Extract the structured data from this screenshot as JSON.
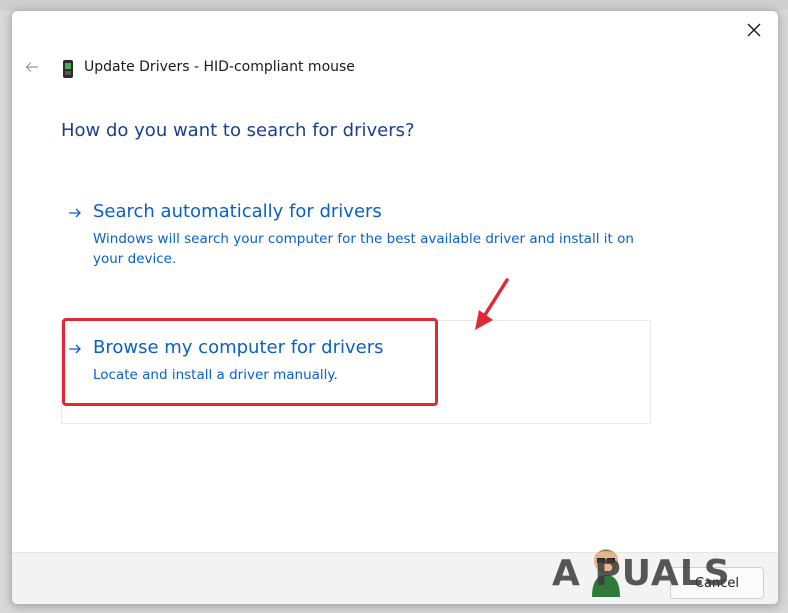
{
  "dialog": {
    "title": "Update Drivers - HID-compliant mouse",
    "heading": "How do you want to search for drivers?",
    "options": [
      {
        "title": "Search automatically for drivers",
        "description": "Windows will search your computer for the best available driver and install it on your device."
      },
      {
        "title": "Browse my computer for drivers",
        "description": "Locate and install a driver manually."
      }
    ],
    "cancel_label": "Cancel"
  },
  "watermark": {
    "text": "A PUALS"
  },
  "icons": {
    "close": "close-icon",
    "back": "back-arrow-icon",
    "device": "mouse-device-icon",
    "option_arrow": "arrow-right-icon",
    "callout": "red-callout-arrow-icon"
  },
  "colors": {
    "heading": "#1a3f91",
    "link": "#0a5fcc",
    "highlight": "#e02a33"
  }
}
